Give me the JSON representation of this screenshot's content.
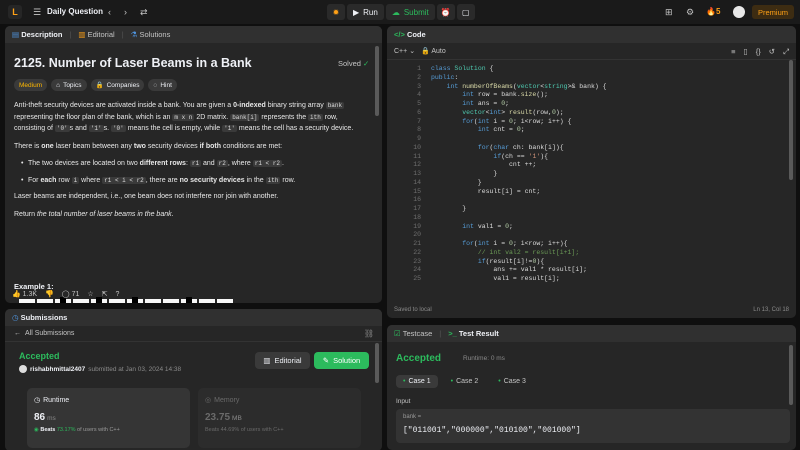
{
  "topnav": {
    "title": "Daily Question",
    "run_label": "Run",
    "submit_label": "Submit",
    "streak": "5",
    "premium_label": "Premium"
  },
  "description": {
    "tabs": [
      "Description",
      "Editorial",
      "Solutions"
    ],
    "title": "2125. Number of Laser Beams in a Bank",
    "solved_label": "Solved",
    "tags": [
      "Medium",
      "Topics",
      "Companies",
      "Hint"
    ],
    "p1_a": "Anti-theft security devices are activated inside a bank. You are given a ",
    "p1_b": "0-indexed",
    "p1_c": " binary string array ",
    "p1_code1": "bank",
    "p1_d": " representing the floor plan of the bank, which is an ",
    "p1_code2": "m x n",
    "p1_e": " 2D matrix. ",
    "p1_code3": "bank[i]",
    "p1_f": " represents the ",
    "p1_code4": "ith",
    "p1_g": " row, consisting of ",
    "p1_code5": "'0'",
    "p1_h": "s and ",
    "p1_code6": "'1'",
    "p1_i": "s. ",
    "p1_code7": "'0'",
    "p1_j": " means the cell is empty, while ",
    "p1_code8": "'1'",
    "p1_k": " means the cell has a security device.",
    "p2_a": "There is ",
    "p2_b": "one",
    "p2_c": " laser beam between any ",
    "p2_d": "two",
    "p2_e": " security devices ",
    "p2_f": "if both",
    "p2_g": " conditions are met:",
    "li1_a": "The two devices are located on two ",
    "li1_b": "different rows",
    "li1_c": ": ",
    "li1_code1": "r1",
    "li1_d": " and ",
    "li1_code2": "r2",
    "li1_e": ", where ",
    "li1_code3": "r1 < r2",
    "li1_f": ".",
    "li2_a": "For ",
    "li2_b": "each",
    "li2_c": " row ",
    "li2_code1": "i",
    "li2_d": " where ",
    "li2_code2": "r1 < i < r2",
    "li2_e": ", there are ",
    "li2_f": "no security devices",
    "li2_g": " in the ",
    "li2_code3": "ith",
    "li2_h": " row.",
    "p3": "Laser beams are independent, i.e., one beam does not interfere nor join with another.",
    "p4_a": "Return ",
    "p4_b": "the total number of laser beams in the bank",
    "p4_c": ".",
    "example_title": "Example 1:",
    "likes": "1.3K",
    "comments": "71"
  },
  "submissions": {
    "tab_label": "Submissions",
    "back_label": "All Submissions",
    "status": "Accepted",
    "user": "rishabhmittal2407",
    "submitted_text": "submitted at Jan 03, 2024 14:38",
    "editorial_label": "Editorial",
    "solution_label": "Solution",
    "runtime": {
      "label": "Runtime",
      "value": "86",
      "unit": "ms",
      "beats_prefix": "Beats",
      "pct": "73.17%",
      "suffix": "of users with C++"
    },
    "memory": {
      "label": "Memory",
      "value": "23.75",
      "unit": "MB",
      "beats_prefix": "Beats",
      "pct": "44.69%",
      "suffix": "of users with C++"
    }
  },
  "editor": {
    "tab_label": "Code",
    "language": "C++",
    "mode": "Auto",
    "saved_label": "Saved to local",
    "cursor": "Ln 13, Col 18"
  },
  "testcase": {
    "tabs": [
      "Testcase",
      "Test Result"
    ],
    "status": "Accepted",
    "runtime_text": "Runtime: 0 ms",
    "cases": [
      "Case 1",
      "Case 2",
      "Case 3"
    ],
    "input_label": "Input",
    "var_name": "bank =",
    "var_value": "[\"011001\",\"000000\",\"010100\",\"001000\"]"
  },
  "colors": {
    "accent_green": "#2cbb5d",
    "accent_orange": "#ffa116",
    "panel_bg": "#262626"
  }
}
